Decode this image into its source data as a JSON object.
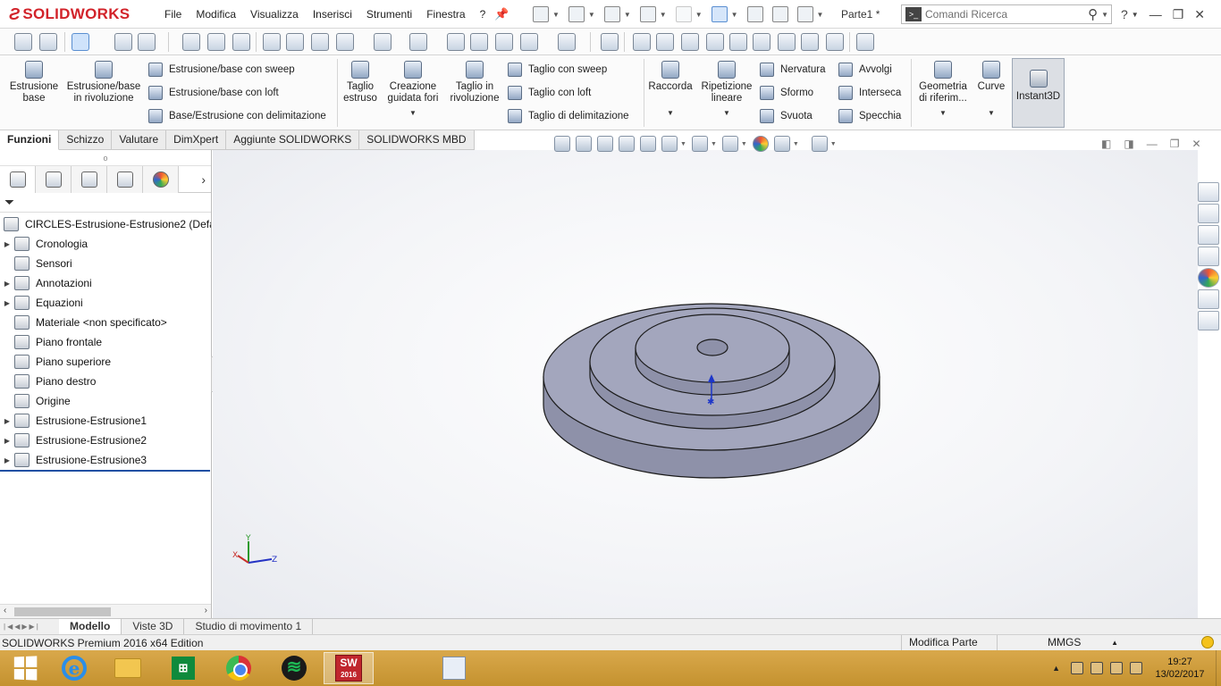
{
  "app": {
    "logo_text": "SOLIDWORKS",
    "document_title": "Parte1 *",
    "accent_color": "#d2232a"
  },
  "menu": [
    "File",
    "Modifica",
    "Visualizza",
    "Inserisci",
    "Strumenti",
    "Finestra",
    "?"
  ],
  "search": {
    "placeholder": "Comandi Ricerca"
  },
  "help_label": "?",
  "command_manager": {
    "estrusione_base": "Estrusione\nbase",
    "estrusione_rivoluzione": "Estrusione/base\nin rivoluzione",
    "estrusione_sweep": "Estrusione/base con sweep",
    "estrusione_loft": "Estrusione/base con loft",
    "base_delimitazione": "Base/Estrusione con delimitazione",
    "taglio_estruso": "Taglio\nestruso",
    "creazione_fori": "Creazione\nguidata fori",
    "taglio_rivoluzione": "Taglio in\nrivoluzione",
    "taglio_sweep": "Taglio con sweep",
    "taglio_loft": "Taglio con loft",
    "taglio_delimitazione": "Taglio di delimitazione",
    "raccorda": "Raccorda",
    "ripetizione_lineare": "Ripetizione\nlineare",
    "nervatura": "Nervatura",
    "sformo": "Sformo",
    "svuota": "Svuota",
    "avvolgi": "Avvolgi",
    "interseca": "Interseca",
    "specchia": "Specchia",
    "geometria_riferimento": "Geometria\ndi riferim...",
    "curve": "Curve",
    "instant3d": "Instant3D"
  },
  "command_tabs": [
    "Funzioni",
    "Schizzo",
    "Valutare",
    "DimXpert",
    "Aggiunte SOLIDWORKS",
    "SOLIDWORKS MBD"
  ],
  "feature_tree": {
    "root": "CIRCLES-Estrusione-Estrusione2  (Defau",
    "items": [
      {
        "label": "Cronologia",
        "icon": "history-folder-icon",
        "expandable": true
      },
      {
        "label": "Sensori",
        "icon": "sensors-icon",
        "expandable": false
      },
      {
        "label": "Annotazioni",
        "icon": "annotations-icon",
        "expandable": true
      },
      {
        "label": "Equazioni",
        "icon": "equations-icon",
        "expandable": true
      },
      {
        "label": "Materiale <non specificato>",
        "icon": "material-icon",
        "expandable": false
      },
      {
        "label": "Piano frontale",
        "icon": "plane-icon",
        "expandable": false
      },
      {
        "label": "Piano superiore",
        "icon": "plane-icon",
        "expandable": false
      },
      {
        "label": "Piano destro",
        "icon": "plane-icon",
        "expandable": false
      },
      {
        "label": "Origine",
        "icon": "origin-icon",
        "expandable": false
      },
      {
        "label": "Estrusione-Estrusione1",
        "icon": "extrude-feature-icon",
        "expandable": true
      },
      {
        "label": "Estrusione-Estrusione2",
        "icon": "extrude-feature-icon",
        "expandable": true
      },
      {
        "label": "Estrusione-Estrusione3",
        "icon": "extrude-feature-icon",
        "expandable": true
      }
    ]
  },
  "bottom_tabs": [
    "Modello",
    "Viste 3D",
    "Studio di movimento 1"
  ],
  "status": {
    "edition": "SOLIDWORKS Premium 2016 x64 Edition",
    "mode": "Modifica Parte",
    "units": "MMGS"
  },
  "triad": {
    "x": "X",
    "y": "Y",
    "z": "Z"
  },
  "taskbar": {
    "solidworks_label": "SW",
    "solidworks_year": "2016",
    "store_label": "⊞",
    "ie_label": "e",
    "clock_time": "19:27",
    "clock_date": "13/02/2017"
  },
  "part_colors": {
    "top": "#a3a6bd",
    "side": "#8e91a9",
    "edge": "#1b1b1b"
  }
}
